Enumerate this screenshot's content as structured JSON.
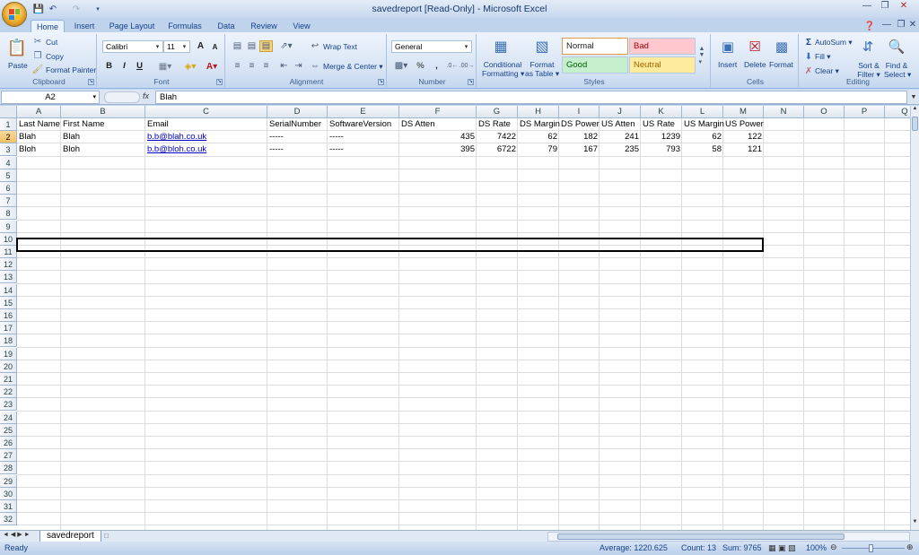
{
  "window": {
    "title": "savedreport  [Read-Only] - Microsoft Excel"
  },
  "tabs": [
    "Home",
    "Insert",
    "Page Layout",
    "Formulas",
    "Data",
    "Review",
    "View"
  ],
  "clipboard": {
    "paste": "Paste",
    "cut": "Cut",
    "copy": "Copy",
    "format_painter": "Format Painter",
    "group": "Clipboard"
  },
  "font": {
    "name": "Calibri",
    "size": "11",
    "bold": "B",
    "italic": "I",
    "underline": "U",
    "grow": "A",
    "shrink": "A",
    "group": "Font"
  },
  "alignment": {
    "wrap": "Wrap Text",
    "merge": "Merge & Center",
    "group": "Alignment"
  },
  "number": {
    "format": "General",
    "percent": "%",
    "comma": ",",
    "group": "Number"
  },
  "styles": {
    "conditional": "Conditional",
    "conditional2": "Formatting",
    "format_table": "Format",
    "format_table2": "as Table",
    "normal": "Normal",
    "bad": "Bad",
    "good": "Good",
    "neutral": "Neutral",
    "group": "Styles"
  },
  "cells": {
    "insert": "Insert",
    "delete": "Delete",
    "format": "Format",
    "group": "Cells"
  },
  "editing": {
    "autosum": "AutoSum",
    "fill": "Fill",
    "clear": "Clear",
    "sort": "Sort &",
    "sort2": "Filter",
    "find": "Find &",
    "find2": "Select",
    "group": "Editing"
  },
  "formula_bar": {
    "name_box": "A2",
    "fx": "fx",
    "value": "Blah"
  },
  "columns": [
    "A",
    "B",
    "C",
    "D",
    "E",
    "F",
    "G",
    "H",
    "I",
    "J",
    "K",
    "L",
    "M",
    "N",
    "O",
    "P",
    "Q"
  ],
  "rows": [
    "1",
    "2",
    "3",
    "4",
    "5",
    "6",
    "7",
    "8",
    "9",
    "10",
    "11",
    "12",
    "13",
    "14",
    "15",
    "16",
    "17",
    "18",
    "19",
    "20",
    "21",
    "22",
    "23",
    "24",
    "25",
    "26",
    "27",
    "28",
    "29",
    "30",
    "31",
    "32"
  ],
  "sheet": {
    "headers": [
      "Last Name",
      "First Name",
      "Email",
      "SerialNumber",
      "SoftwareVersion",
      "DS Atten",
      "DS Rate",
      "DS Margin",
      "DS Power",
      "US Atten",
      "US Rate",
      "US Margin",
      "US Power"
    ],
    "rows": [
      [
        "Blah",
        "Blah",
        "b.b@blah.co.uk",
        "-----",
        "-----",
        "435",
        "7422",
        "62",
        "182",
        "241",
        "1239",
        "62",
        "122"
      ],
      [
        "Bloh",
        "Bloh",
        "b.b@bloh.co.uk",
        "-----",
        "-----",
        "395",
        "6722",
        "79",
        "167",
        "235",
        "793",
        "58",
        "121"
      ]
    ]
  },
  "sheet_tab": "savedreport",
  "status": {
    "ready": "Ready",
    "average": "Average: 1220.625",
    "count": "Count: 13",
    "sum": "Sum: 9765",
    "zoom": "100%"
  }
}
